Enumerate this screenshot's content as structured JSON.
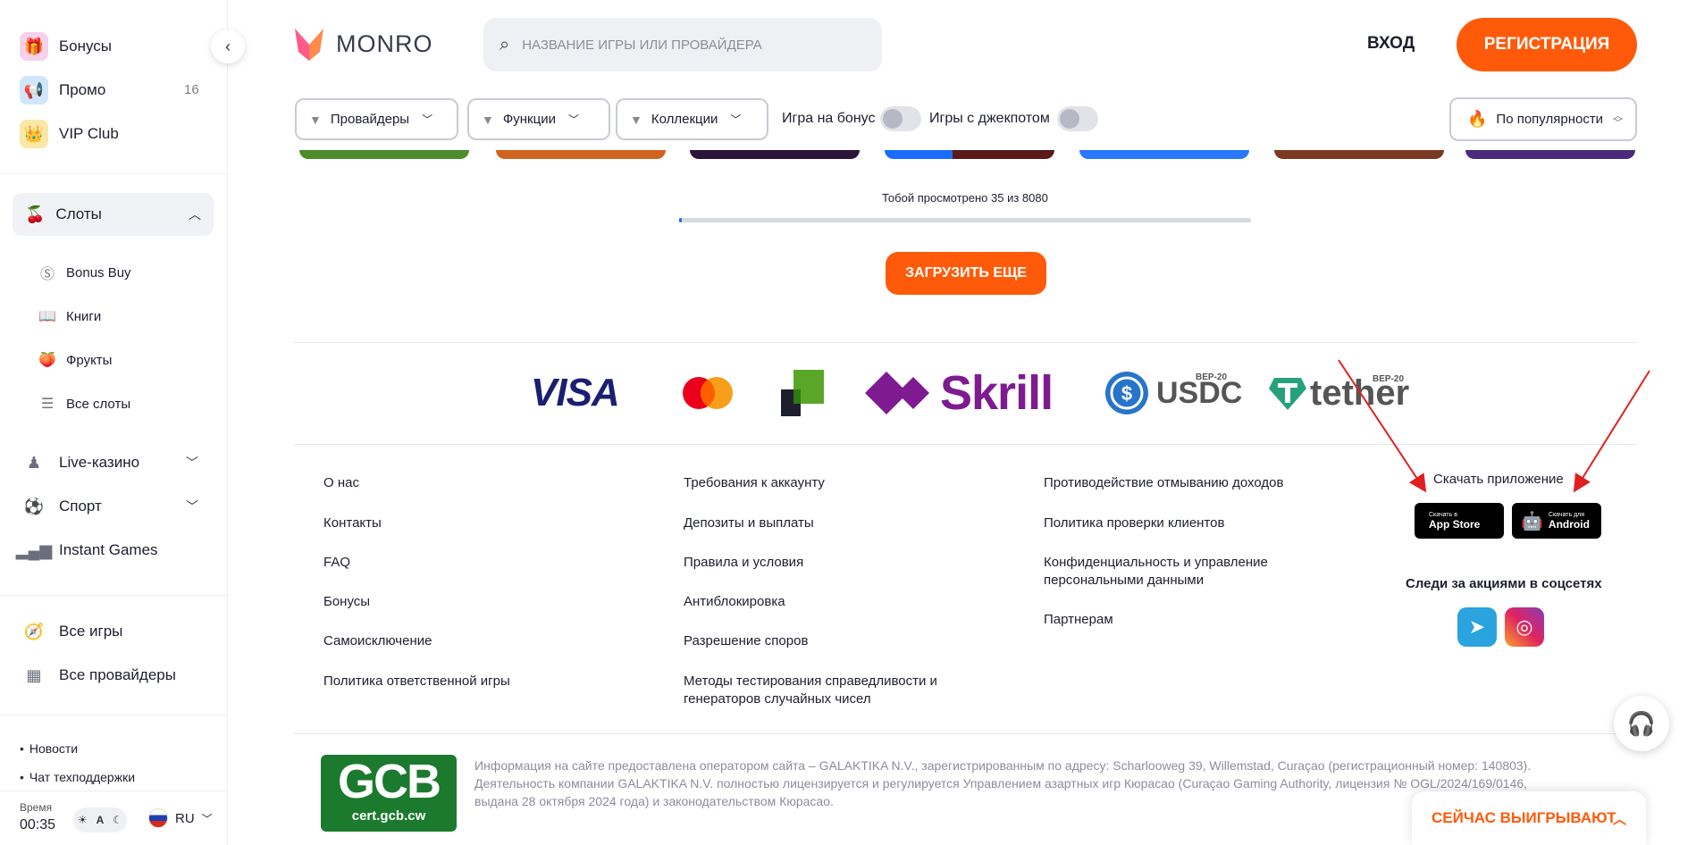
{
  "sidebar": {
    "top_items": [
      {
        "label": "Бонусы",
        "icon": "gift-icon"
      },
      {
        "label": "Промо",
        "icon": "promo-icon",
        "badge": "16"
      },
      {
        "label": "VIP Club",
        "icon": "crown-icon"
      }
    ],
    "slots": {
      "label": "Слоты",
      "icon": "cherry-icon",
      "sub_items": [
        {
          "label": "Bonus Buy",
          "icon": "dollar-circle-icon"
        },
        {
          "label": "Книги",
          "icon": "book-icon"
        },
        {
          "label": "Фрукты",
          "icon": "fruit-icon"
        },
        {
          "label": "Все слоты",
          "icon": "list-icon"
        }
      ]
    },
    "sections": [
      {
        "label": "Live-казино",
        "icon": "dealer-icon"
      },
      {
        "label": "Спорт",
        "icon": "ball-icon"
      },
      {
        "label": "Instant Games",
        "icon": "bar-chart-icon"
      }
    ],
    "all_items": [
      {
        "label": "Все игры",
        "icon": "compass-icon"
      },
      {
        "label": "Все провайдеры",
        "icon": "grid-icon"
      }
    ],
    "links": [
      "Новости",
      "Чат техподдержки"
    ],
    "time_label": "Время",
    "time_value": "00:35",
    "theme_mode": "A",
    "language": "RU"
  },
  "header": {
    "logo_text": "MONRO",
    "search_placeholder": "НАЗВАНИЕ ИГРЫ ИЛИ ПРОВАЙДЕРА",
    "login_label": "ВХОД",
    "register_label": "РЕГИСТРАЦИЯ"
  },
  "filters": {
    "providers_label": "Провайдеры",
    "features_label": "Функции",
    "collections_label": "Коллекции",
    "bonus_toggle_label": "Игра на бонус",
    "jackpot_toggle_label": "Игры с джекпотом",
    "sort_label": "По популярности"
  },
  "progress": {
    "text": "Тобой просмотрено 35 из 8080",
    "viewed": 35,
    "total": 8080,
    "load_more_label": "ЗАГРУЗИТЬ ЕЩЕ"
  },
  "payments": {
    "visa": "VISA",
    "skrill": "Skrill",
    "usdc": "USDC",
    "usdc_network": "BEP-20",
    "tether": "tether",
    "tether_network": "BEP-20"
  },
  "footer": {
    "col1": [
      "О нас",
      "Контакты",
      "FAQ",
      "Бонусы",
      "Самоисключение",
      "Политика ответственной игры"
    ],
    "col2": [
      "Требования к аккаунту",
      "Депозиты и выплаты",
      "Правила и условия",
      "Антиблокировка",
      "Разрешение споров",
      "Методы тестирования справедливости и генераторов случайных чисел"
    ],
    "col3": [
      "Противодействие отмыванию доходов",
      "Политика проверки клиентов",
      "Конфиденциальность и управление персональными данными",
      "Партнерам"
    ],
    "app_title": "Скачать приложение",
    "appstore_small": "Скачать в",
    "appstore_big": "App Store",
    "android_small": "Скачать для",
    "android_big": "Android",
    "social_title": "Следи за акциями в соцсетях",
    "gcb_big": "GCB",
    "gcb_small": "cert.gcb.cw",
    "legal": "Информация на сайте предоставлена оператором сайта – GALAKTIKA N.V., зарегистрированным по адресу: Scharlooweg 39, Willemstad, Curaçao (регистрационный номер: 140803). Деятельность компании GALAKTIKA N.V. полностью лицензируется и регулируется Управлением азартных игр Кюрасао (Curaçao Gaming Authority, лицензия № OGL/2024/169/0146, выдана 28 октября 2024 года) и законодательством Кюрасао."
  },
  "widgets": {
    "winning_label": "СЕЙЧАС ВЫИГРЫВАЮТ"
  },
  "colors": {
    "accent": "#ff5a0a",
    "progress": "#1a6dff",
    "annotation_arrow": "#e02020"
  }
}
